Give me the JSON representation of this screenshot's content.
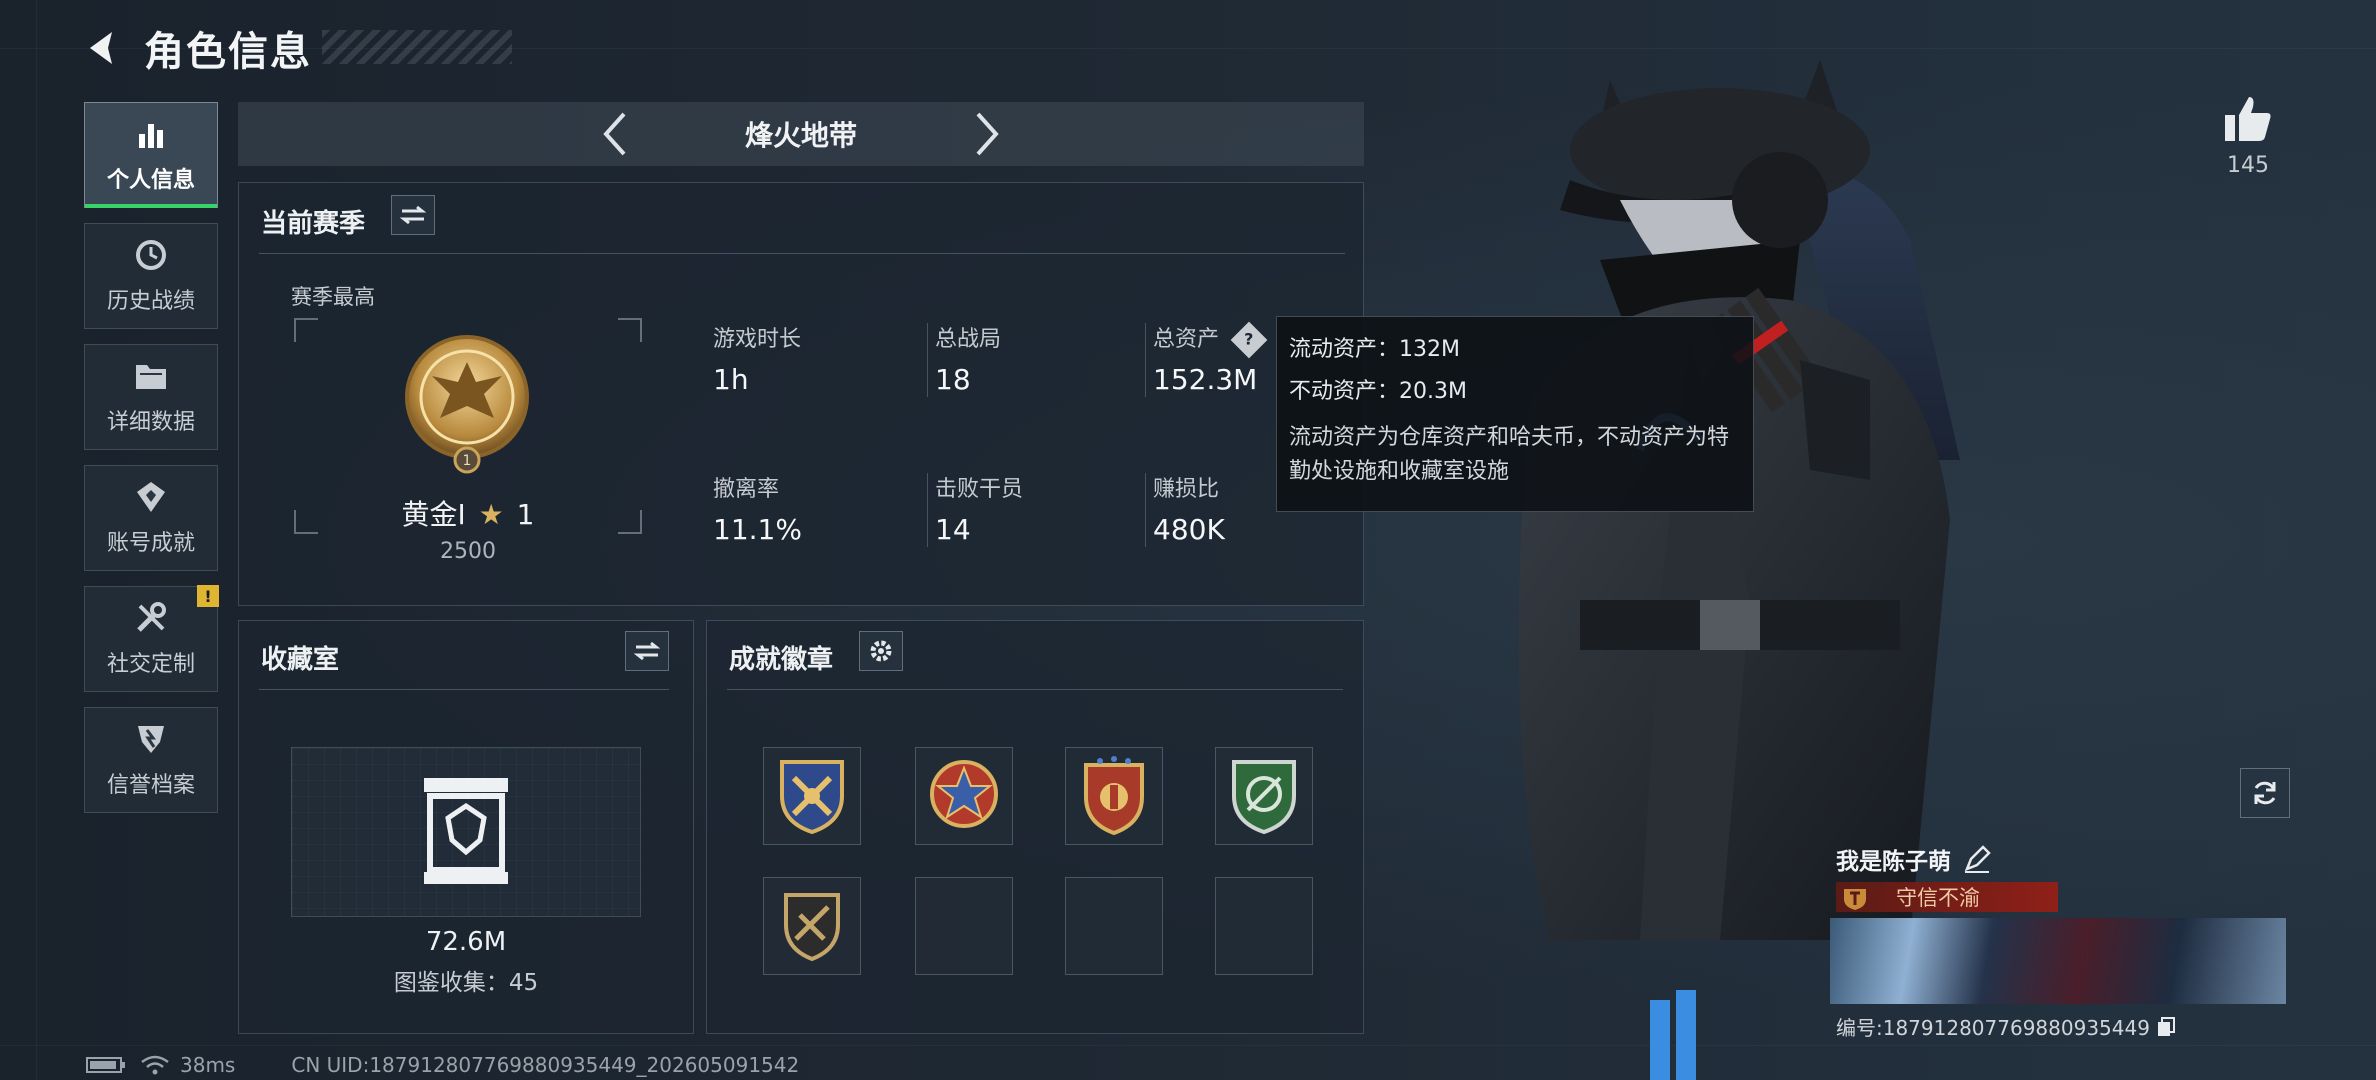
{
  "header": {
    "title": "角色信息"
  },
  "nav": {
    "items": [
      {
        "label": "个人信息",
        "icon": "bar-chart-icon"
      },
      {
        "label": "历史战绩",
        "icon": "history-clock-icon"
      },
      {
        "label": "详细数据",
        "icon": "folder-icon"
      },
      {
        "label": "账号成就",
        "icon": "achievement-icon"
      },
      {
        "label": "社交定制",
        "icon": "tools-icon"
      },
      {
        "label": "信誉档案",
        "icon": "credit-shield-icon"
      }
    ],
    "alert_badge": "!"
  },
  "mode": {
    "title": "烽火地带"
  },
  "season": {
    "title": "当前赛季",
    "sub_label": "赛季最高",
    "rank_name": "黄金Ⅰ",
    "rank_stars": "1",
    "rank_score": "2500",
    "stats": [
      {
        "label": "游戏时长",
        "value": "1h"
      },
      {
        "label": "总战局",
        "value": "18"
      },
      {
        "label": "总资产",
        "value": "152.3M"
      },
      {
        "label": "撤离率",
        "value": "11.1%"
      },
      {
        "label": "击败干员",
        "value": "14"
      },
      {
        "label": "赚损比",
        "value": "480K"
      }
    ]
  },
  "tooltip": {
    "line1": "流动资产：132M",
    "line2": "不动资产：20.3M",
    "desc": "流动资产为仓库资产和哈夫币，不动资产为特勤处设施和收藏室设施"
  },
  "collection": {
    "title": "收藏室",
    "value": "72.6M",
    "count_text": "图鉴收集：45"
  },
  "badges": {
    "title": "成就徽章"
  },
  "profile": {
    "likes": "145",
    "player_name": "我是陈子萌",
    "title": "守信不渝",
    "player_id": "编号:18791280776988093544​9"
  },
  "status": {
    "ping": "38ms",
    "uid": "CN UID:18791280776988093544​9_202605091542"
  },
  "colors": {
    "active_accent": "#38d46a",
    "alert": "#e0b531",
    "title_bar": "#8f2018"
  }
}
